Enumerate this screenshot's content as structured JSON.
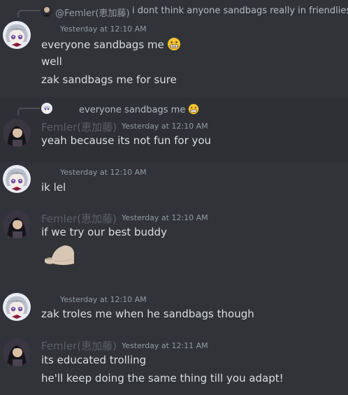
{
  "messages": [
    {
      "reply": {
        "author": "@Femler(恵加藤)",
        "text": "i dont think anyone sandbags really in friendlies"
      },
      "author": "",
      "timestamp": "Yesterday at 12:10 AM",
      "lines": [
        {
          "text": "everyone sandbags me",
          "emoji": "grimacing-emoji"
        },
        {
          "text": "well"
        },
        {
          "text": "zak sandbags me for sure"
        }
      ]
    },
    {
      "reply": {
        "author": "",
        "text": "everyone sandbags me",
        "emoji": "grimacing-emoji"
      },
      "author": "Femler(恵加藤)",
      "timestamp": "Yesterday at 12:10 AM",
      "lines": [
        {
          "text": "yeah because its not fun for you"
        }
      ]
    },
    {
      "author": "",
      "timestamp": "Yesterday at 12:10 AM",
      "lines": [
        {
          "text": "ik lel"
        }
      ]
    },
    {
      "author": "Femler(恵加藤)",
      "timestamp": "Yesterday at 12:10 AM",
      "lines": [
        {
          "text": "if we try our best buddy"
        }
      ],
      "attachment": "image-attachment"
    },
    {
      "author": "",
      "timestamp": "Yesterday at 12:10 AM",
      "lines": [
        {
          "text": "zak troles me when he sandbags though"
        }
      ]
    },
    {
      "author": "Femler(恵加藤)",
      "timestamp": "Yesterday at 12:11 AM",
      "lines": [
        {
          "text": "its educated trolling"
        },
        {
          "text": "he'll keep doing the same thing till you adapt!"
        }
      ]
    }
  ],
  "colors": {
    "background": "#313338",
    "message_text": "#dbdee1",
    "timestamp": "#949ba4",
    "author_name": "#5c5e66",
    "emoji_face": "#f4c431"
  }
}
